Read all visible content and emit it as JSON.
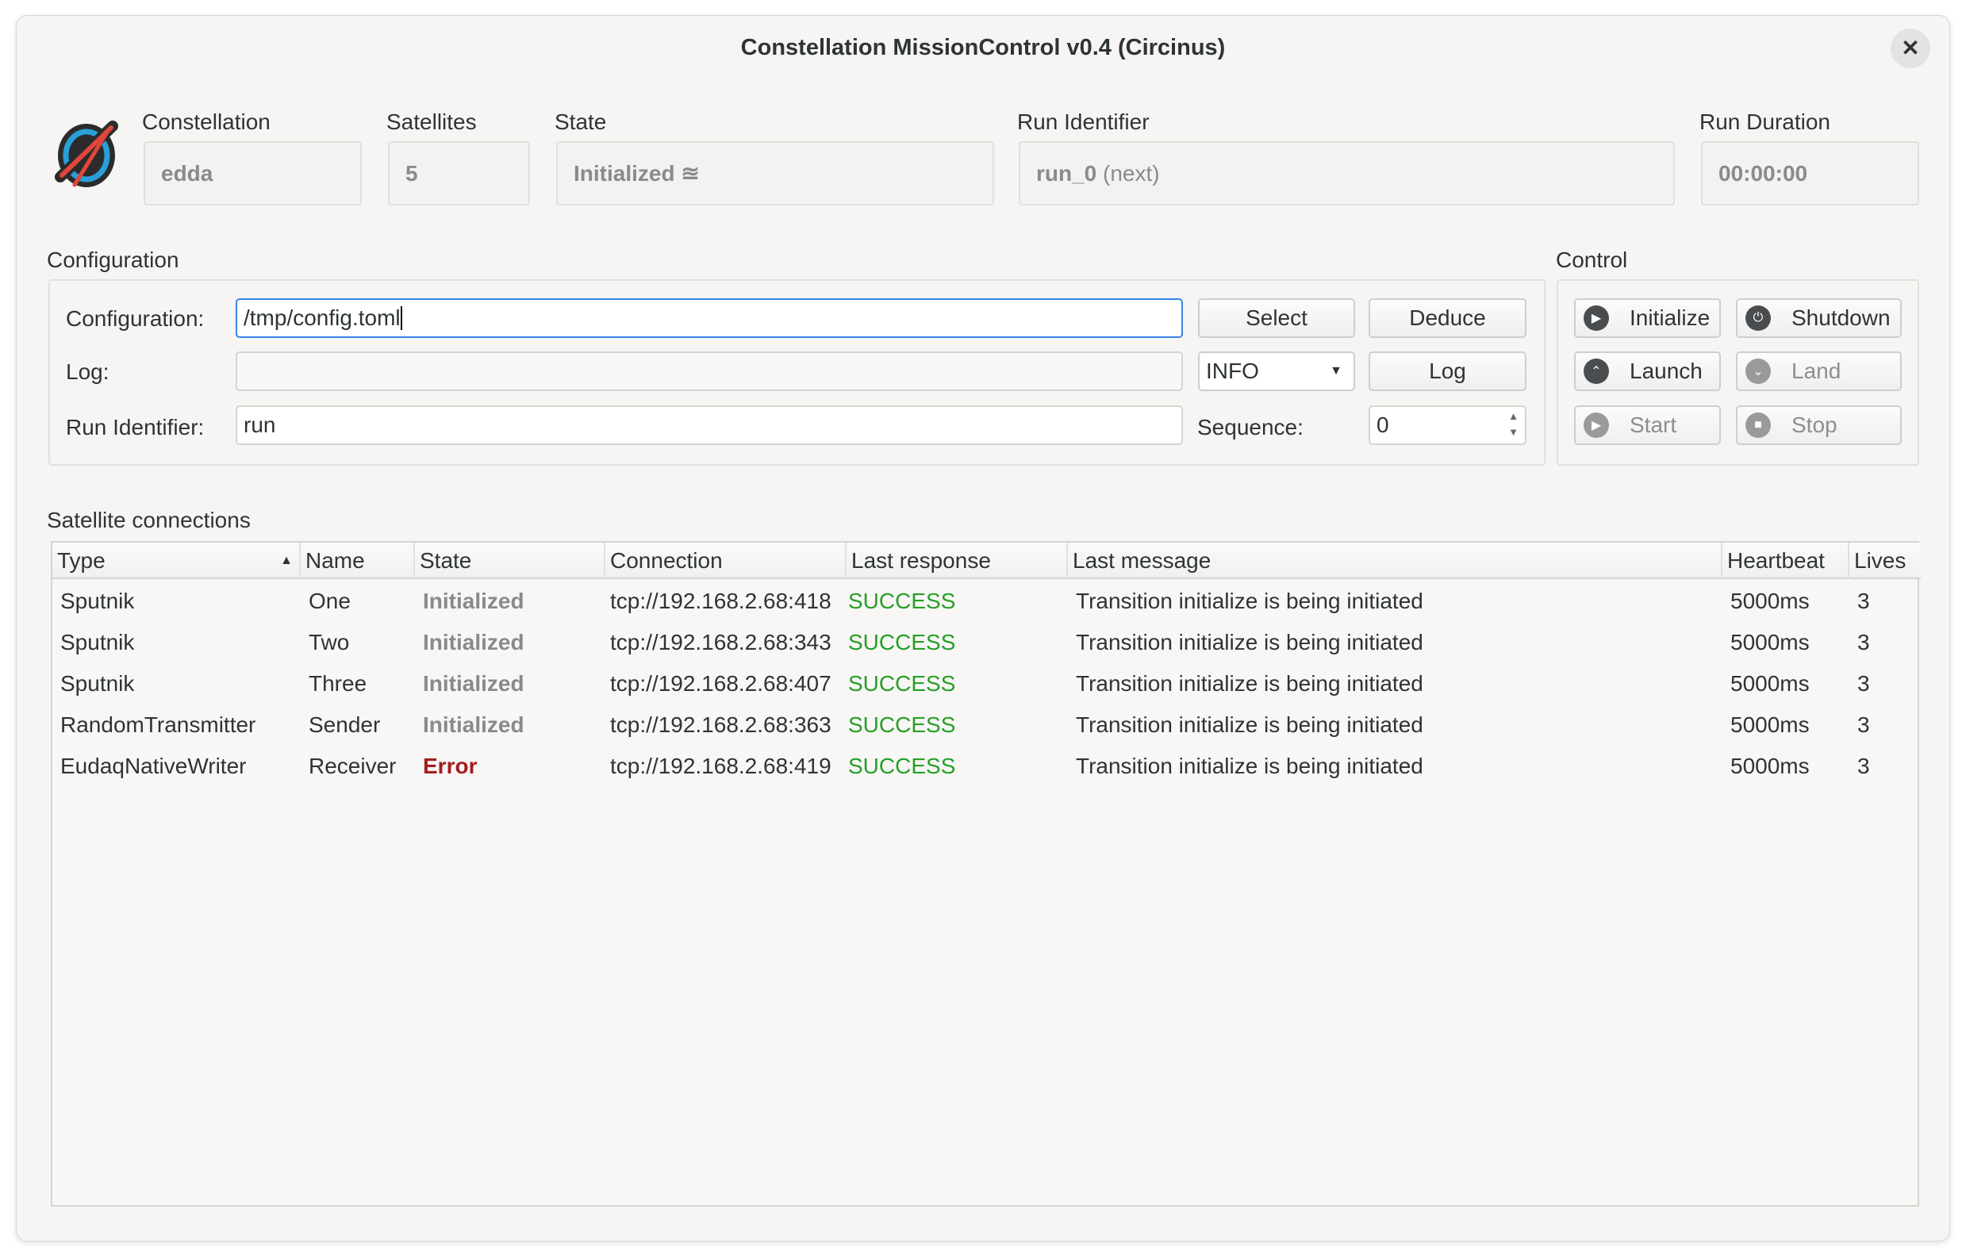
{
  "window": {
    "title": "Constellation MissionControl v0.4 (Circinus)",
    "close_icon": "close-icon"
  },
  "header": {
    "constellation_label": "Constellation",
    "constellation_value": "edda",
    "satellites_label": "Satellites",
    "satellites_value": "5",
    "state_label": "State",
    "state_value": "Initialized ≊",
    "run_identifier_label": "Run Identifier",
    "run_identifier_value": "run_0",
    "run_identifier_suffix": "(next)",
    "run_duration_label": "Run Duration",
    "run_duration_value": "00:00:00"
  },
  "configuration": {
    "group_label": "Configuration",
    "config_label": "Configuration:",
    "config_value": "/tmp/config.toml",
    "select_label": "Select",
    "deduce_label": "Deduce",
    "log_label": "Log:",
    "log_value": "",
    "log_level": "INFO",
    "log_button": "Log",
    "run_id_label": "Run Identifier:",
    "run_id_value": "run",
    "sequence_label": "Sequence:",
    "sequence_value": "0"
  },
  "control": {
    "group_label": "Control",
    "buttons": [
      {
        "label": "Initialize",
        "icon": "initialize-icon",
        "enabled": true
      },
      {
        "label": "Shutdown",
        "icon": "power-icon",
        "enabled": true
      },
      {
        "label": "Launch",
        "icon": "chevron-up-icon",
        "enabled": true
      },
      {
        "label": "Land",
        "icon": "chevron-down-icon",
        "enabled": false
      },
      {
        "label": "Start",
        "icon": "play-icon",
        "enabled": false
      },
      {
        "label": "Stop",
        "icon": "stop-icon",
        "enabled": false
      }
    ]
  },
  "satellites": {
    "label": "Satellite connections",
    "columns": [
      "Type",
      "Name",
      "State",
      "Connection",
      "Last response",
      "Last message",
      "Heartbeat",
      "Lives"
    ],
    "sort_indicator": "▲",
    "rows": [
      {
        "type": "Sputnik",
        "name": "One",
        "state": "Initialized",
        "connection": "tcp://192.168.2.68:418",
        "response": "SUCCESS",
        "message": "Transition initialize is being initiated",
        "heartbeat": "5000ms",
        "lives": "3"
      },
      {
        "type": "Sputnik",
        "name": "Two",
        "state": "Initialized",
        "connection": "tcp://192.168.2.68:343",
        "response": "SUCCESS",
        "message": "Transition initialize is being initiated",
        "heartbeat": "5000ms",
        "lives": "3"
      },
      {
        "type": "Sputnik",
        "name": "Three",
        "state": "Initialized",
        "connection": "tcp://192.168.2.68:407",
        "response": "SUCCESS",
        "message": "Transition initialize is being initiated",
        "heartbeat": "5000ms",
        "lives": "3"
      },
      {
        "type": "RandomTransmitter",
        "name": "Sender",
        "state": "Initialized",
        "connection": "tcp://192.168.2.68:363",
        "response": "SUCCESS",
        "message": "Transition initialize is being initiated",
        "heartbeat": "5000ms",
        "lives": "3"
      },
      {
        "type": "EudaqNativeWriter",
        "name": "Receiver",
        "state": "Error",
        "connection": "tcp://192.168.2.68:419",
        "response": "SUCCESS",
        "message": "Transition initialize is being initiated",
        "heartbeat": "5000ms",
        "lives": "3"
      }
    ]
  }
}
